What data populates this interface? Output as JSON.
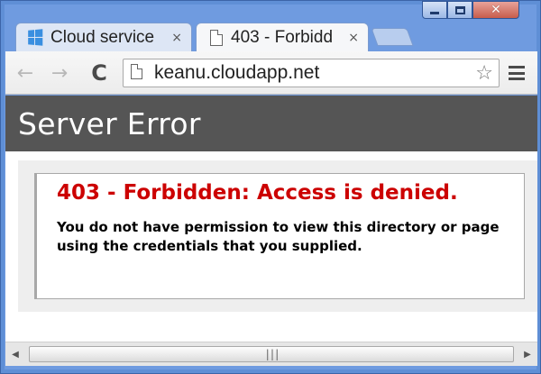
{
  "window": {
    "caption_buttons": {
      "minimize_icon": "minimize-icon",
      "maximize_icon": "maximize-icon",
      "close_icon": "close-icon",
      "close_glyph": "✕"
    }
  },
  "tabs": [
    {
      "label": "Cloud service",
      "icon": "windows-logo-icon",
      "close_glyph": "×",
      "active": false
    },
    {
      "label": "403 - Forbidd",
      "icon": "page-icon",
      "close_glyph": "×",
      "active": true
    }
  ],
  "toolbar": {
    "back_glyph": "←",
    "forward_glyph": "→",
    "reload_glyph": "C",
    "address": "keanu.cloudapp.net",
    "star_glyph": "☆"
  },
  "page": {
    "header_title": "Server Error",
    "error_heading": "403 - Forbidden: Access is denied.",
    "error_message": "You do not have permission to view this directory or page using the credentials that you supplied."
  },
  "scrollbar": {
    "left_glyph": "◀",
    "right_glyph": "▶",
    "grip_glyph": "|||"
  },
  "colors": {
    "header_bg": "#555555",
    "error_heading": "#cc0000",
    "window_frame": "#5f8fd6"
  }
}
